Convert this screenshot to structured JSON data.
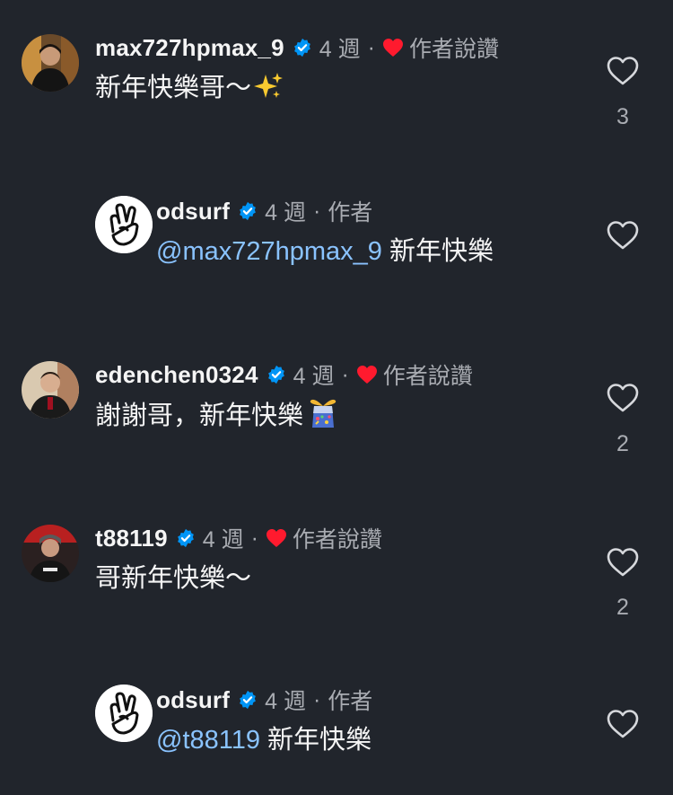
{
  "comments": [
    {
      "username": "max727hpmax_9",
      "time": "4 週",
      "separator": "·",
      "author_label": "作者說讚",
      "text": "新年快樂哥～",
      "emoji": "sparkles-icon",
      "likes": "3"
    },
    {
      "username": "odsurf",
      "time": "4 週",
      "separator": "·",
      "author_label": "作者",
      "mention": "@max727hpmax_9",
      "text": " 新年快樂"
    },
    {
      "username": "edenchen0324",
      "time": "4 週",
      "separator": "·",
      "author_label": "作者說讚",
      "text": "謝謝哥，新年快樂",
      "emoji": "party-confetti-icon",
      "likes": "2"
    },
    {
      "username": "t88119",
      "time": "4 週",
      "separator": "·",
      "author_label": "作者說讚",
      "text": "哥新年快樂～",
      "likes": "2"
    },
    {
      "username": "odsurf",
      "time": "4 週",
      "separator": "·",
      "author_label": "作者",
      "mention": "@t88119",
      "text": " 新年快樂"
    }
  ],
  "colors": {
    "background": "#21252c",
    "verified": "#0095f6",
    "heart": "#ff1a2e",
    "mention": "#8ac3ff",
    "muted": "#a9acb2"
  }
}
